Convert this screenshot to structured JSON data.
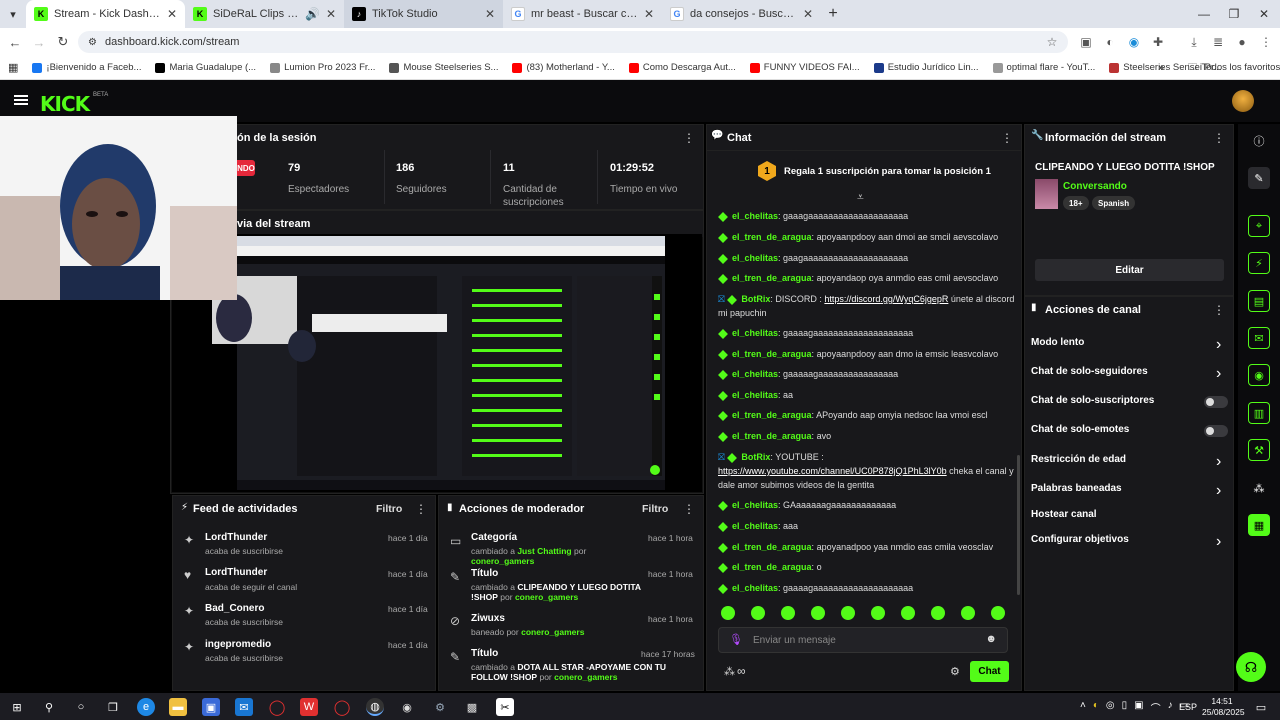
{
  "browser": {
    "tabs": [
      {
        "label": "Stream - Kick Dashboard",
        "active": true
      },
      {
        "label": "SiDeRaL Clips - Watch Live",
        "active": false
      },
      {
        "label": "TikTok Studio",
        "active": false
      },
      {
        "label": "mr beast - Buscar con Google",
        "active": false
      },
      {
        "label": "da consejos - Buscar con Googl",
        "active": false
      }
    ],
    "url": "dashboard.kick.com/stream",
    "bookmarks": [
      "¡Bienvenido a Faceb...",
      "Maria Guadalupe (...",
      "Lumion Pro 2023 Fr...",
      "Mouse Steelseries S...",
      "(83) Motherland - Y...",
      "Como Descarga Aut...",
      "FUNNY VIDEOS FAI...",
      "Estudio Jurídico Lin...",
      "optimal flare - YouT...",
      "Steelseries Sensei Pr..."
    ],
    "bookmarks_all": "Todos los favoritos"
  },
  "kick": {
    "logo": "KICK",
    "beta": "BETA"
  },
  "session": {
    "title": "ón de la sesión",
    "live_badge": "NDO",
    "stats": [
      {
        "value": "79",
        "label": "Espectadores"
      },
      {
        "value": "186",
        "label": "Seguidores"
      },
      {
        "value": "11",
        "label": "Cantidad de suscripciones"
      },
      {
        "value": "01:29:52",
        "label": "Tiempo en vivo"
      }
    ],
    "preview_title": "via del stream"
  },
  "activity_feed": {
    "title": "Feed de actividades",
    "filter": "Filtro",
    "items": [
      {
        "name": "LordThunder",
        "action": "acaba de suscribirse",
        "time": "hace 1 día"
      },
      {
        "name": "LordThunder",
        "action": "acaba de seguir el canal",
        "time": "hace 1 día"
      },
      {
        "name": "Bad_Conero",
        "action": "acaba de suscribirse",
        "time": "hace 1 día"
      },
      {
        "name": "ingepromedio",
        "action": "acaba de suscribirse",
        "time": "hace 1 día"
      }
    ]
  },
  "mod_actions": {
    "title": "Acciones de moderador",
    "filter": "Filtro",
    "items": [
      {
        "title": "Categoría",
        "pre": "cambiado a ",
        "target": "Just Chatting",
        "mid": " por ",
        "by": "conero_gamers",
        "time": "hace 1 hora"
      },
      {
        "title": "Título",
        "pre": "cambiado a ",
        "target": "CLIPEANDO Y LUEGO DOTITA !SHOP",
        "mid": " por ",
        "by": "conero_gamers",
        "time": "hace 1 hora"
      },
      {
        "title": "Ziwuxs",
        "pre": "baneado ",
        "target": "",
        "mid": "por ",
        "by": "conero_gamers",
        "time": "hace 1 hora"
      },
      {
        "title": "Título",
        "pre": "cambiado a ",
        "target": "DOTA ALL STAR -APOYAME CON TU FOLLOW !SHOP",
        "mid": " por ",
        "by": "conero_gamers",
        "time": "hace 17 horas"
      }
    ]
  },
  "chat": {
    "title": "Chat",
    "pinned": "Regala 1 suscripción para tomar la posición 1",
    "pinned_rank": "1",
    "messages": [
      {
        "user": "el_chelitas",
        "text": "gaaagaaaaaaaaaaaaaaaaaaaa"
      },
      {
        "user": "el_tren_de_aragua",
        "text": "apoyaanpdooy aan dmoi ae smcil aevscolavo"
      },
      {
        "user": "el_chelitas",
        "text": "gaagaaaaaaaaaaaaaaaaaaaaa"
      },
      {
        "user": "el_tren_de_aragua",
        "text": "apoyandaop oya anmdio eas cmil aevsoclavo"
      },
      {
        "user": "BotRix",
        "text": "DISCORD : ",
        "link": "https://discord.gg/WyqC6jgepR",
        "after": " únete al discord mi papuchin"
      },
      {
        "user": "el_chelitas",
        "text": "gaaaagaaaaaaaaaaaaaaaaaaaa"
      },
      {
        "user": "el_tren_de_aragua",
        "text": "apoyaanpdooy aan dmo ia emsic leasvcolavo"
      },
      {
        "user": "el_chelitas",
        "text": "gaaaaagaaaaaaaaaaaaaaaa"
      },
      {
        "user": "el_chelitas",
        "text": "aa"
      },
      {
        "user": "el_tren_de_aragua",
        "text": "APoyando aap omyia nedsoc laa vmoi escl"
      },
      {
        "user": "el_tren_de_aragua",
        "text": "avo"
      },
      {
        "user": "BotRix",
        "text": "YOUTUBE : ",
        "link": "https://www.youtube.com/channel/UC0P878jQ1PhL3lY0b",
        "after": " cheka el canal y dale amor subimos videos de la gentita"
      },
      {
        "user": "el_chelitas",
        "text": "GAaaaaaagaaaaaaaaaaaaa"
      },
      {
        "user": "el_chelitas",
        "text": "aaa"
      },
      {
        "user": "el_tren_de_aragua",
        "text": "apoyanadpoo yaa nmdio eas cmila veosclav"
      },
      {
        "user": "el_tren_de_aragua",
        "text": "o"
      },
      {
        "user": "el_chelitas",
        "text": "gaaaagaaaaaaaaaaaaaaaaaaaa"
      }
    ],
    "input_placeholder": "Enviar un mensaje",
    "send_label": "Chat",
    "infinity": "∞"
  },
  "stream_info": {
    "title": "Información del stream",
    "stream_title": "CLIPEANDO Y LUEGO DOTITA !SHOP",
    "category": "Conversando",
    "tags": [
      "18+",
      "Spanish"
    ],
    "edit_label": "Editar"
  },
  "channel_actions": {
    "title": "Acciones de canal",
    "items": [
      {
        "label": "Modo lento",
        "control": "arrow"
      },
      {
        "label": "Chat de solo-seguidores",
        "control": "arrow"
      },
      {
        "label": "Chat de solo-suscriptores",
        "control": "toggle"
      },
      {
        "label": "Chat de solo-emotes",
        "control": "toggle"
      },
      {
        "label": "Restricción de edad",
        "control": "arrow"
      },
      {
        "label": "Palabras baneadas",
        "control": "arrow"
      },
      {
        "label": "Hostear canal",
        "control": "none"
      },
      {
        "label": "Configurar objetivos",
        "control": "arrow"
      }
    ]
  },
  "taskbar": {
    "lang": "ESP",
    "time": "14:51",
    "date": "25/08/2025"
  },
  "colors": {
    "kick_green": "#53fc18",
    "panel": "#18181b",
    "live_red": "#e5283b"
  }
}
